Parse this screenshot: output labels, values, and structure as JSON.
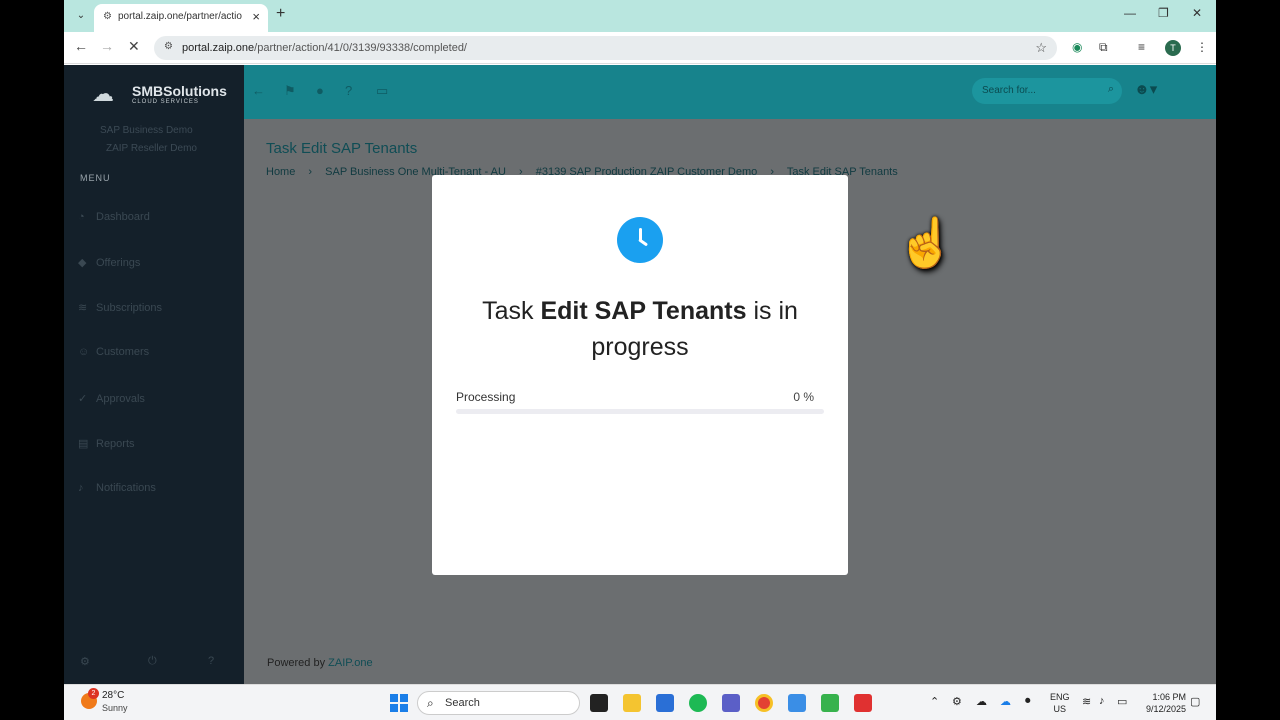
{
  "browser": {
    "tab_title": "portal.zaip.one/partner/action/",
    "url_host": "portal.zaip.one",
    "url_path": "/partner/action/41/0/3139/93338/completed/"
  },
  "app": {
    "brand": "SMBSolutions",
    "brand_sub": "CLOUD SERVICES",
    "context_1": "SAP Business Demo",
    "context_2": "ZAIP Reseller Demo",
    "menu_label": "MENU",
    "menu_items": [
      "Dashboard",
      "Offerings",
      "Subscriptions",
      "Customers",
      "Approvals",
      "Reports",
      "Notifications"
    ],
    "search_placeholder": "Search for...",
    "page_title": "Task Edit SAP Tenants",
    "breadcrumb": [
      "Home",
      "SAP Business One Multi-Tenant - AU",
      "#3139 SAP Production ZAIP Customer Demo",
      "Task Edit SAP Tenants"
    ],
    "footer_prefix": "Powered by",
    "footer_link": "ZAIP.one"
  },
  "modal": {
    "msg_prefix": "Task",
    "msg_bold": "Edit SAP Tenants",
    "msg_suffix": "is in progress",
    "progress_label": "Processing",
    "progress_pct_text": "0 %",
    "progress_value": 0
  },
  "taskbar": {
    "weather_badge": "2",
    "temperature": "28°C",
    "weather": "Sunny",
    "search_label": "Search",
    "lang_1": "ENG",
    "lang_2": "US",
    "time": "1:06 PM",
    "date": "9/12/2025"
  },
  "colors": {
    "topbar": "#17838c",
    "sidebar": "#14202a",
    "accent": "#1aa0f0"
  }
}
